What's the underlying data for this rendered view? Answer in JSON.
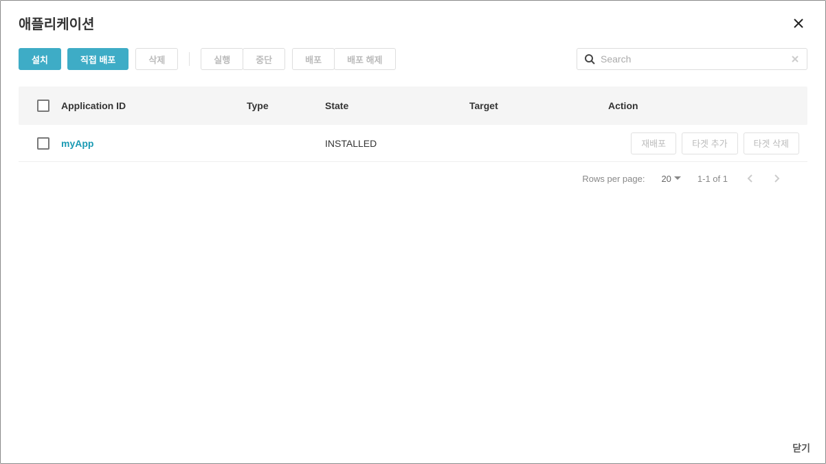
{
  "modal": {
    "title": "애플리케이션",
    "close_label": "Close"
  },
  "toolbar": {
    "install": "설치",
    "direct_deploy": "직접 배포",
    "delete": "삭제",
    "run": "실행",
    "stop": "중단",
    "deploy": "배포",
    "undeploy": "배포 해제"
  },
  "search": {
    "placeholder": "Search",
    "value": ""
  },
  "table": {
    "columns": {
      "app_id": "Application ID",
      "type": "Type",
      "state": "State",
      "target": "Target",
      "action": "Action"
    },
    "rows": [
      {
        "app_id": "myApp",
        "type": "",
        "state": "INSTALLED",
        "target": "",
        "actions": {
          "redeploy": "재배포",
          "add_target": "타겟 추가",
          "delete_target": "타겟 삭제"
        }
      }
    ]
  },
  "pagination": {
    "rows_per_page_label": "Rows per page:",
    "page_size": "20",
    "range": "1-1 of 1"
  },
  "footer": {
    "close": "닫기"
  }
}
